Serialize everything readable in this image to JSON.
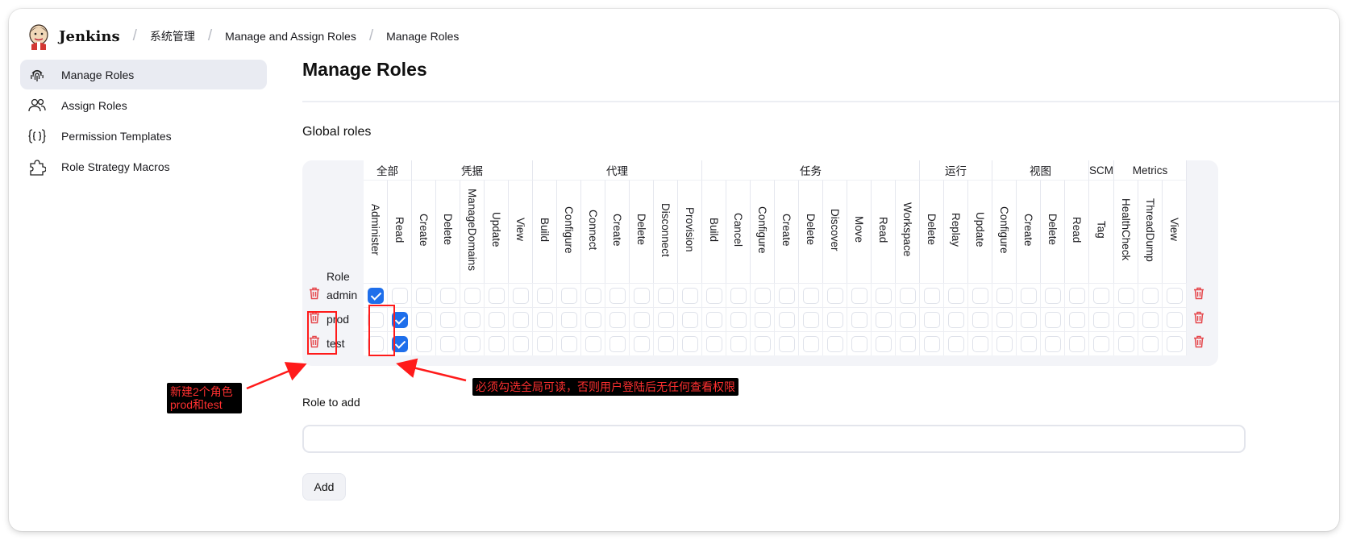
{
  "breadcrumb": {
    "brand": "Jenkins",
    "items": [
      "系统管理",
      "Manage and Assign Roles",
      "Manage Roles"
    ]
  },
  "sidebar": {
    "items": [
      {
        "label": "Manage Roles",
        "icon": "fingerprint-icon",
        "active": true
      },
      {
        "label": "Assign Roles",
        "icon": "users-icon",
        "active": false
      },
      {
        "label": "Permission Templates",
        "icon": "braces-icon",
        "active": false
      },
      {
        "label": "Role Strategy Macros",
        "icon": "puzzle-icon",
        "active": false
      }
    ]
  },
  "main": {
    "title": "Manage Roles",
    "section": "Global roles",
    "role_header": "Role",
    "groups": [
      {
        "label": "全部",
        "perms": [
          "Administer",
          "Read"
        ]
      },
      {
        "label": "凭据",
        "perms": [
          "Create",
          "Delete",
          "ManageDomains",
          "Update",
          "View"
        ]
      },
      {
        "label": "代理",
        "perms": [
          "Build",
          "Configure",
          "Connect",
          "Create",
          "Delete",
          "Disconnect",
          "Provision"
        ]
      },
      {
        "label": "任务",
        "perms": [
          "Build",
          "Cancel",
          "Configure",
          "Create",
          "Delete",
          "Discover",
          "Move",
          "Read",
          "Workspace"
        ]
      },
      {
        "label": "运行",
        "perms": [
          "Delete",
          "Replay",
          "Update"
        ]
      },
      {
        "label": "视图",
        "perms": [
          "Configure",
          "Create",
          "Delete",
          "Read"
        ]
      },
      {
        "label": "SCM",
        "perms": [
          "Tag"
        ]
      },
      {
        "label": "Metrics",
        "perms": [
          "HealthCheck",
          "ThreadDump",
          "View"
        ]
      }
    ],
    "roles": [
      {
        "name": "admin",
        "checked": [
          0
        ]
      },
      {
        "name": "prod",
        "checked": [
          1
        ]
      },
      {
        "name": "test",
        "checked": [
          1
        ]
      }
    ],
    "role_to_add_label": "Role to add",
    "role_to_add_value": "",
    "add_button": "Add"
  },
  "annotations": {
    "new_roles_note": [
      "新建2个角色",
      "prod和test"
    ],
    "read_note": "必须勾选全局可读，否则用户登陆后无任何查看权限"
  },
  "colors": {
    "accent": "#1f6feb",
    "annotation_red": "#ff1a1a",
    "delete_red": "#e5484d",
    "active_bg": "#e9ebf2"
  }
}
